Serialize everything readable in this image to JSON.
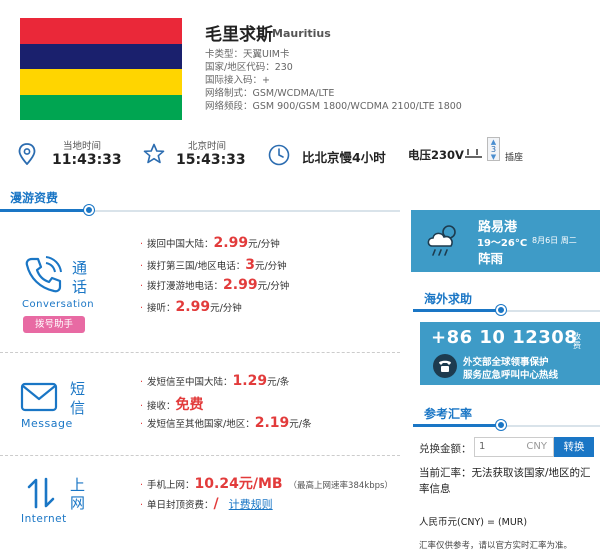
{
  "country": {
    "name_cn": "毛里求斯",
    "name_en": "Mauritius"
  },
  "flag_colors": [
    "#ea2839",
    "#1a206d",
    "#ffd500",
    "#00a551"
  ],
  "info": [
    "卡类型：天翼UIM卡",
    "国家/地区代码：230",
    "国际接入码：+",
    "网络制式：GSM/WCDMA/LTE",
    "网络频段：GSM 900/GSM 1800/WCDMA 2100/LTE 1800"
  ],
  "timebar": {
    "local_label": "当地时间",
    "local_time": "11:43:33",
    "bj_label": "北京时间",
    "bj_time": "15:43:33",
    "diff": "比北京慢4小时",
    "voltage": "电压230V",
    "plug_num": "3",
    "plug_label": "插座"
  },
  "roaming": {
    "title": "漫游资费"
  },
  "conversation": {
    "cat1": "通",
    "cat2": "话",
    "en": "Conversation",
    "dial_btn": "拨号助手",
    "rows": [
      {
        "label": "拨回中国大陆：",
        "price": "2.99",
        "unit": "元/分钟"
      },
      {
        "label": "拨打第三国/地区电话：",
        "price": "3",
        "unit": "元/分钟"
      },
      {
        "label": "拨打漫游地电话：",
        "price": "2.99",
        "unit": "元/分钟"
      },
      {
        "label": "接听：",
        "price": "2.99",
        "unit": "元/分钟"
      }
    ]
  },
  "message": {
    "cat1": "短",
    "cat2": "信",
    "en": "Message",
    "rows": [
      {
        "label": "发短信至中国大陆：",
        "price": "1.29",
        "unit": "元/条"
      },
      {
        "label": "接收：",
        "price": "免费",
        "unit": ""
      },
      {
        "label": "发短信至其他国家/地区：",
        "price": "2.19",
        "unit": "元/条"
      }
    ]
  },
  "internet": {
    "cat1": "上",
    "cat2": "网",
    "en": "Internet",
    "row1_label": "手机上网：",
    "row1_price": "10.24元/MB",
    "row1_note": "（最高上网速率384kbps）",
    "row2_label": "单日封顶资费：",
    "row2_price": "/",
    "row2_link": "计费规则"
  },
  "weather": {
    "city": "路易港",
    "temp": "19～26°C",
    "date": "8月6日 周二",
    "desc": "阵雨"
  },
  "help": {
    "title": "海外求助",
    "number": "+86 10 12308",
    "side": "收费",
    "line1": "外交部全球领事保护",
    "line2": "服务应急呼叫中心热线"
  },
  "exchange": {
    "title": "参考汇率",
    "amount_label": "兑换金额：",
    "amount_value": "1",
    "currency": "CNY",
    "convert_btn": "转换",
    "current_rate": "当前汇率：无法获取该国家/地区的汇率信息",
    "rmb": "人民币元(CNY) = (MUR)",
    "note": "汇率仅供参考，请以官方实时汇率为准。"
  }
}
